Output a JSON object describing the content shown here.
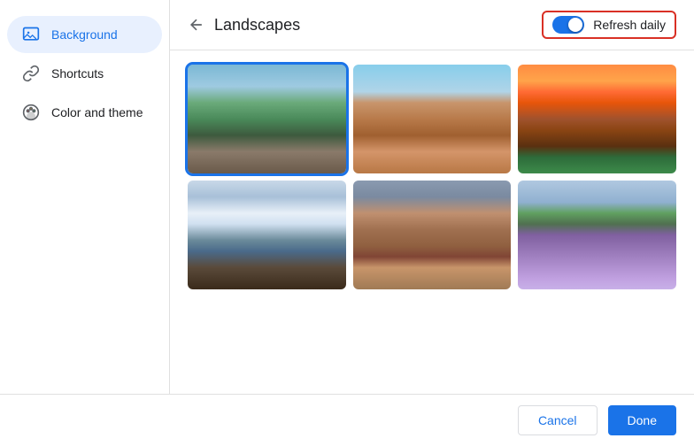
{
  "header": {
    "back_label": "←",
    "title": "Landscapes",
    "refresh_label": "Refresh daily",
    "refresh_enabled": true
  },
  "sidebar": {
    "items": [
      {
        "id": "background",
        "label": "Background",
        "icon": "image-icon",
        "active": true
      },
      {
        "id": "shortcuts",
        "label": "Shortcuts",
        "icon": "link-icon",
        "active": false
      },
      {
        "id": "color-theme",
        "label": "Color and theme",
        "icon": "palette-icon",
        "active": false
      }
    ]
  },
  "images": [
    {
      "id": "rocky-river",
      "class": "img-rocky-river",
      "alt": "Rocky river landscape",
      "selected": true
    },
    {
      "id": "red-arch",
      "class": "img-red-arch",
      "alt": "Red rock arch landscape",
      "selected": false
    },
    {
      "id": "canyon-sunset",
      "class": "img-canyon-sunset",
      "alt": "Canyon at sunset",
      "selected": false
    },
    {
      "id": "snowy-mountain",
      "class": "img-snowy-mountain",
      "alt": "Snowy mountain peaks",
      "selected": false
    },
    {
      "id": "brown-mesa",
      "class": "img-brown-mesa",
      "alt": "Brown mesa landscape",
      "selected": false
    },
    {
      "id": "lavender-tree",
      "class": "img-lavender-tree",
      "alt": "Lavender field with tree",
      "selected": false
    }
  ],
  "footer": {
    "cancel_label": "Cancel",
    "done_label": "Done"
  }
}
